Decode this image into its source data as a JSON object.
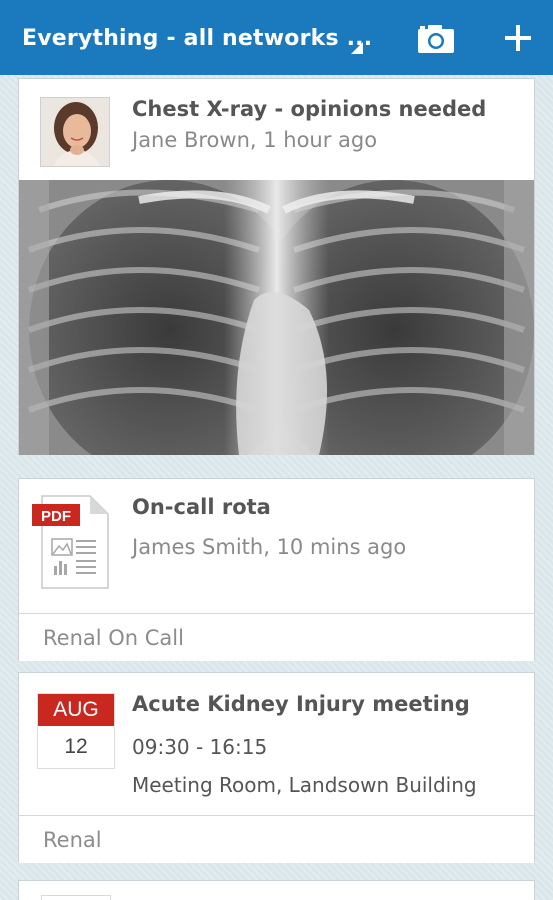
{
  "header": {
    "network_selector": "Everything - all networks ...",
    "camera_icon": "camera-icon",
    "add_icon": "plus-icon"
  },
  "feed": [
    {
      "type": "image-post",
      "title": "Chest X-ray - opinions needed",
      "meta": "Jane Brown, 1 hour ago",
      "avatar": "avatar-photo",
      "image": "chest-xray-image"
    },
    {
      "type": "file-post",
      "title": "On-call rota",
      "meta": "James Smith, 10 mins ago",
      "file_badge": "PDF",
      "footer": "Renal On Call"
    },
    {
      "type": "event-post",
      "title": "Acute Kidney Injury meeting",
      "month": "AUG",
      "day": "12",
      "time": "09:30 - 16:15",
      "location": "Meeting Room, Landsown Building",
      "footer": "Renal"
    }
  ],
  "colors": {
    "header_bg": "#1b79bd",
    "calendar_red": "#c9281f",
    "pdf_red": "#c9281f",
    "page_bg": "#d9e6ea"
  }
}
